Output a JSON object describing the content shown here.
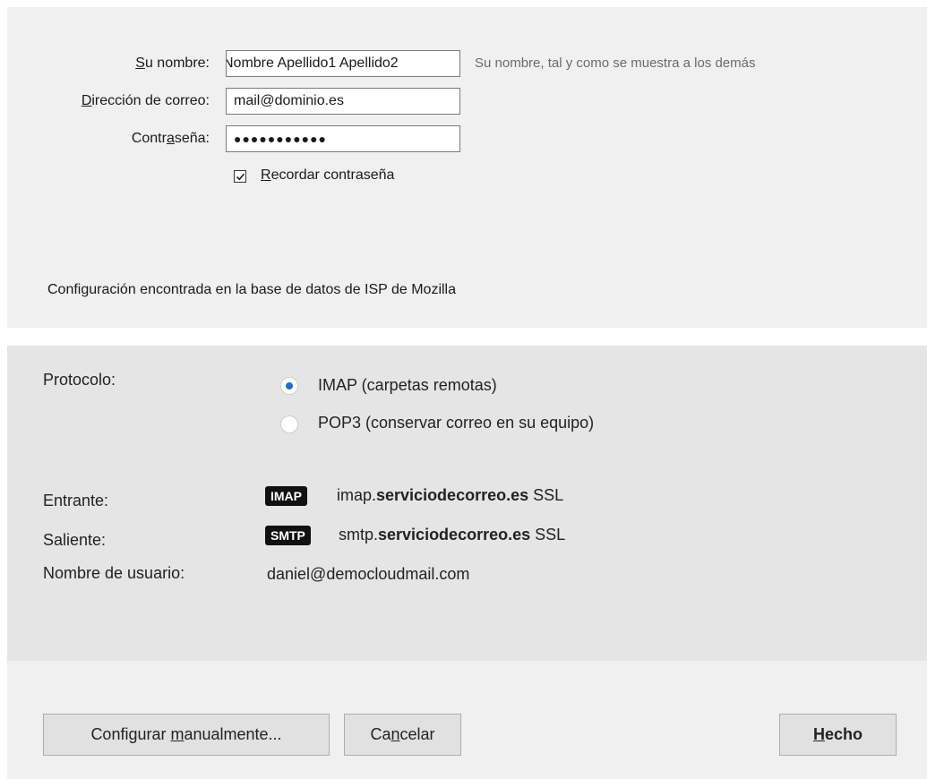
{
  "account": {
    "name_label": "Su nombre:",
    "name_value": "Nombre Apellido1 Apellido2",
    "name_hint": "Su nombre, tal y como se muestra a los demás",
    "email_label": "Dirección de correo:",
    "email_value": "mail@dominio.es",
    "password_label": "Contraseña:",
    "password_mask": "●●●●●●●●●●●",
    "remember_label": "Recordar contraseña",
    "remember_checked": true,
    "status_text": "Configuración encontrada en la base de datos de ISP de Mozilla"
  },
  "protocol": {
    "label": "Protocolo:",
    "options": [
      {
        "label": "IMAP (carpetas remotas)",
        "selected": true
      },
      {
        "label": "POP3 (conservar correo en su equipo)",
        "selected": false
      }
    ]
  },
  "servers": {
    "incoming_label": "Entrante:",
    "incoming_badge": "IMAP",
    "incoming_prefix": "imap.",
    "incoming_domain": "serviciodecorreo.es",
    "incoming_security": "SSL",
    "outgoing_label": "Saliente:",
    "outgoing_badge": "SMTP",
    "outgoing_prefix": "smtp.",
    "outgoing_domain": "serviciodecorreo.es",
    "outgoing_security": "SSL",
    "username_label": "Nombre de usuario:",
    "username_value": "daniel@democloudmail.com"
  },
  "buttons": {
    "manual": "Configurar manualmente...",
    "cancel": "Cancelar",
    "done": "Hecho"
  },
  "colors": {
    "radio_selected": "#1e6fd9",
    "badge_bg": "#111111"
  }
}
